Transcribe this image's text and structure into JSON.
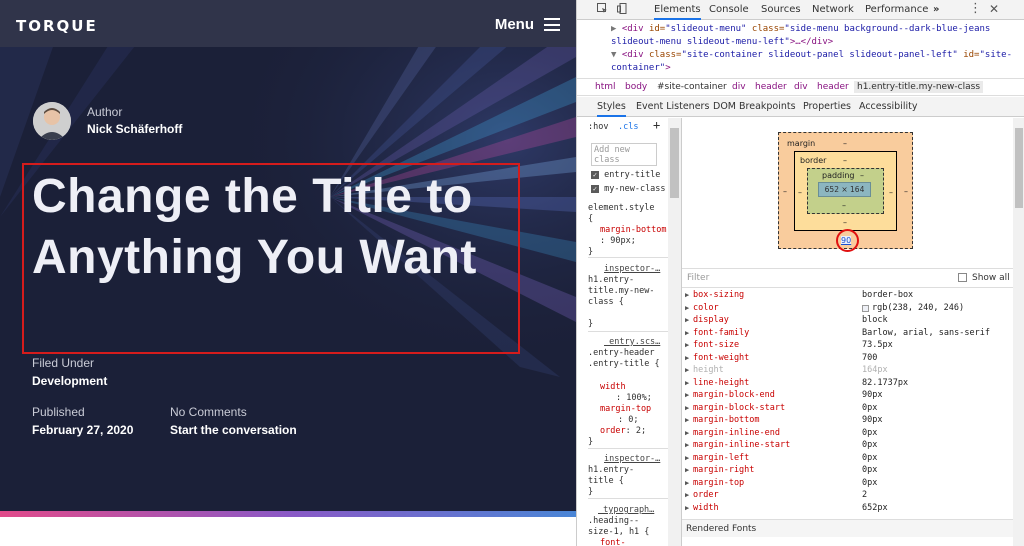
{
  "site": {
    "logo": "TORQUE",
    "menu_label": "Menu",
    "author_label": "Author",
    "author_name": "Nick Schäferhoff",
    "title_line1": "Change the Title to",
    "title_line2": "Anything You Want",
    "filed_label": "Filed Under",
    "filed_value": "Development",
    "published_label": "Published",
    "published_value": "February 27, 2020",
    "comments_label": "No Comments",
    "comments_value": "Start the conversation"
  },
  "devtools": {
    "tabs": [
      "Elements",
      "Console",
      "Sources",
      "Network",
      "Performance"
    ],
    "more": "»",
    "dom": {
      "line1_tag_open": "<div ",
      "line1_attr1": "id=",
      "line1_val1": "\"slideout-menu\"",
      "line1_attr2": " class=",
      "line1_val2": "\"side-menu background--dark-blue-jeans",
      "line2_val": "slideout-menu slideout-menu-left\"",
      "line2_tail": ">…</div>",
      "line3_tag_open": "<div ",
      "line3_attr1": "class=",
      "line3_val1": "\"site-container slideout-panel slideout-panel-left\"",
      "line3_attr2": " id=",
      "line3_val2": "\"site-",
      "line4_val": "container\"",
      "line4_tail": ">"
    },
    "breadcrumbs": [
      "html",
      "body",
      "#site-container",
      "div",
      "header",
      "div",
      "header",
      "h1.entry-title.my-new-class"
    ],
    "subtabs": [
      "Styles",
      "Event Listeners",
      "DOM Breakpoints",
      "Properties",
      "Accessibility"
    ],
    "styles": {
      "hov": ":hov",
      "cls": ".cls",
      "plus": "+",
      "add_class": "Add new class",
      "class1": "entry-title",
      "class2": "my-new-class",
      "element_style": "element.style {",
      "margin_bottom_prop": "margin-bottom",
      "margin_bottom_val": ": 90px;",
      "close": "}",
      "inspector1": "inspector-…",
      "sel1": "h1.entry-title.my-new-class {",
      "entry_scss": "_entry.scs…",
      "sel2": ".entry-header .entry-title {",
      "width_prop": "width",
      "width_val": ": 100%;",
      "mtop_prop": "margin-top",
      "mtop_val": ": 0;",
      "order_prop": "order",
      "order_val": ": 2;",
      "inspector2": "inspector-…",
      "sel3": "h1.entry-title {",
      "typography": "_typograph…",
      "sel4": ".heading--size-1, h1 {",
      "font_prop": "font-"
    },
    "boxmodel": {
      "margin_label": "margin",
      "border_label": "border",
      "padding_label": "padding",
      "content": "652 × 164",
      "dash": "–",
      "margin_bottom": "90"
    },
    "filter_placeholder": "Filter",
    "show_all": "Show all",
    "computed": [
      {
        "name": "box-sizing",
        "value": "border-box"
      },
      {
        "name": "color",
        "value": "rgb(238, 240, 246)"
      },
      {
        "name": "display",
        "value": "block"
      },
      {
        "name": "font-family",
        "value": "Barlow, arial, sans-serif"
      },
      {
        "name": "font-size",
        "value": "73.5px"
      },
      {
        "name": "font-weight",
        "value": "700"
      },
      {
        "name": "height",
        "value": "164px"
      },
      {
        "name": "line-height",
        "value": "82.1737px"
      },
      {
        "name": "margin-block-end",
        "value": "90px"
      },
      {
        "name": "margin-block-start",
        "value": "0px"
      },
      {
        "name": "margin-bottom",
        "value": "90px"
      },
      {
        "name": "margin-inline-end",
        "value": "0px"
      },
      {
        "name": "margin-inline-start",
        "value": "0px"
      },
      {
        "name": "margin-left",
        "value": "0px"
      },
      {
        "name": "margin-right",
        "value": "0px"
      },
      {
        "name": "margin-top",
        "value": "0px"
      },
      {
        "name": "order",
        "value": "2"
      },
      {
        "name": "width",
        "value": "652px"
      }
    ],
    "rendered_fonts": "Rendered Fonts"
  },
  "colors": {
    "site_bg": "#1b2038",
    "highlight": "#d51c1c",
    "margin_box": "#f9cc9d",
    "border_box": "#fddd9b",
    "padding_box": "#c3d08b",
    "content_box": "#8cb6c0"
  }
}
